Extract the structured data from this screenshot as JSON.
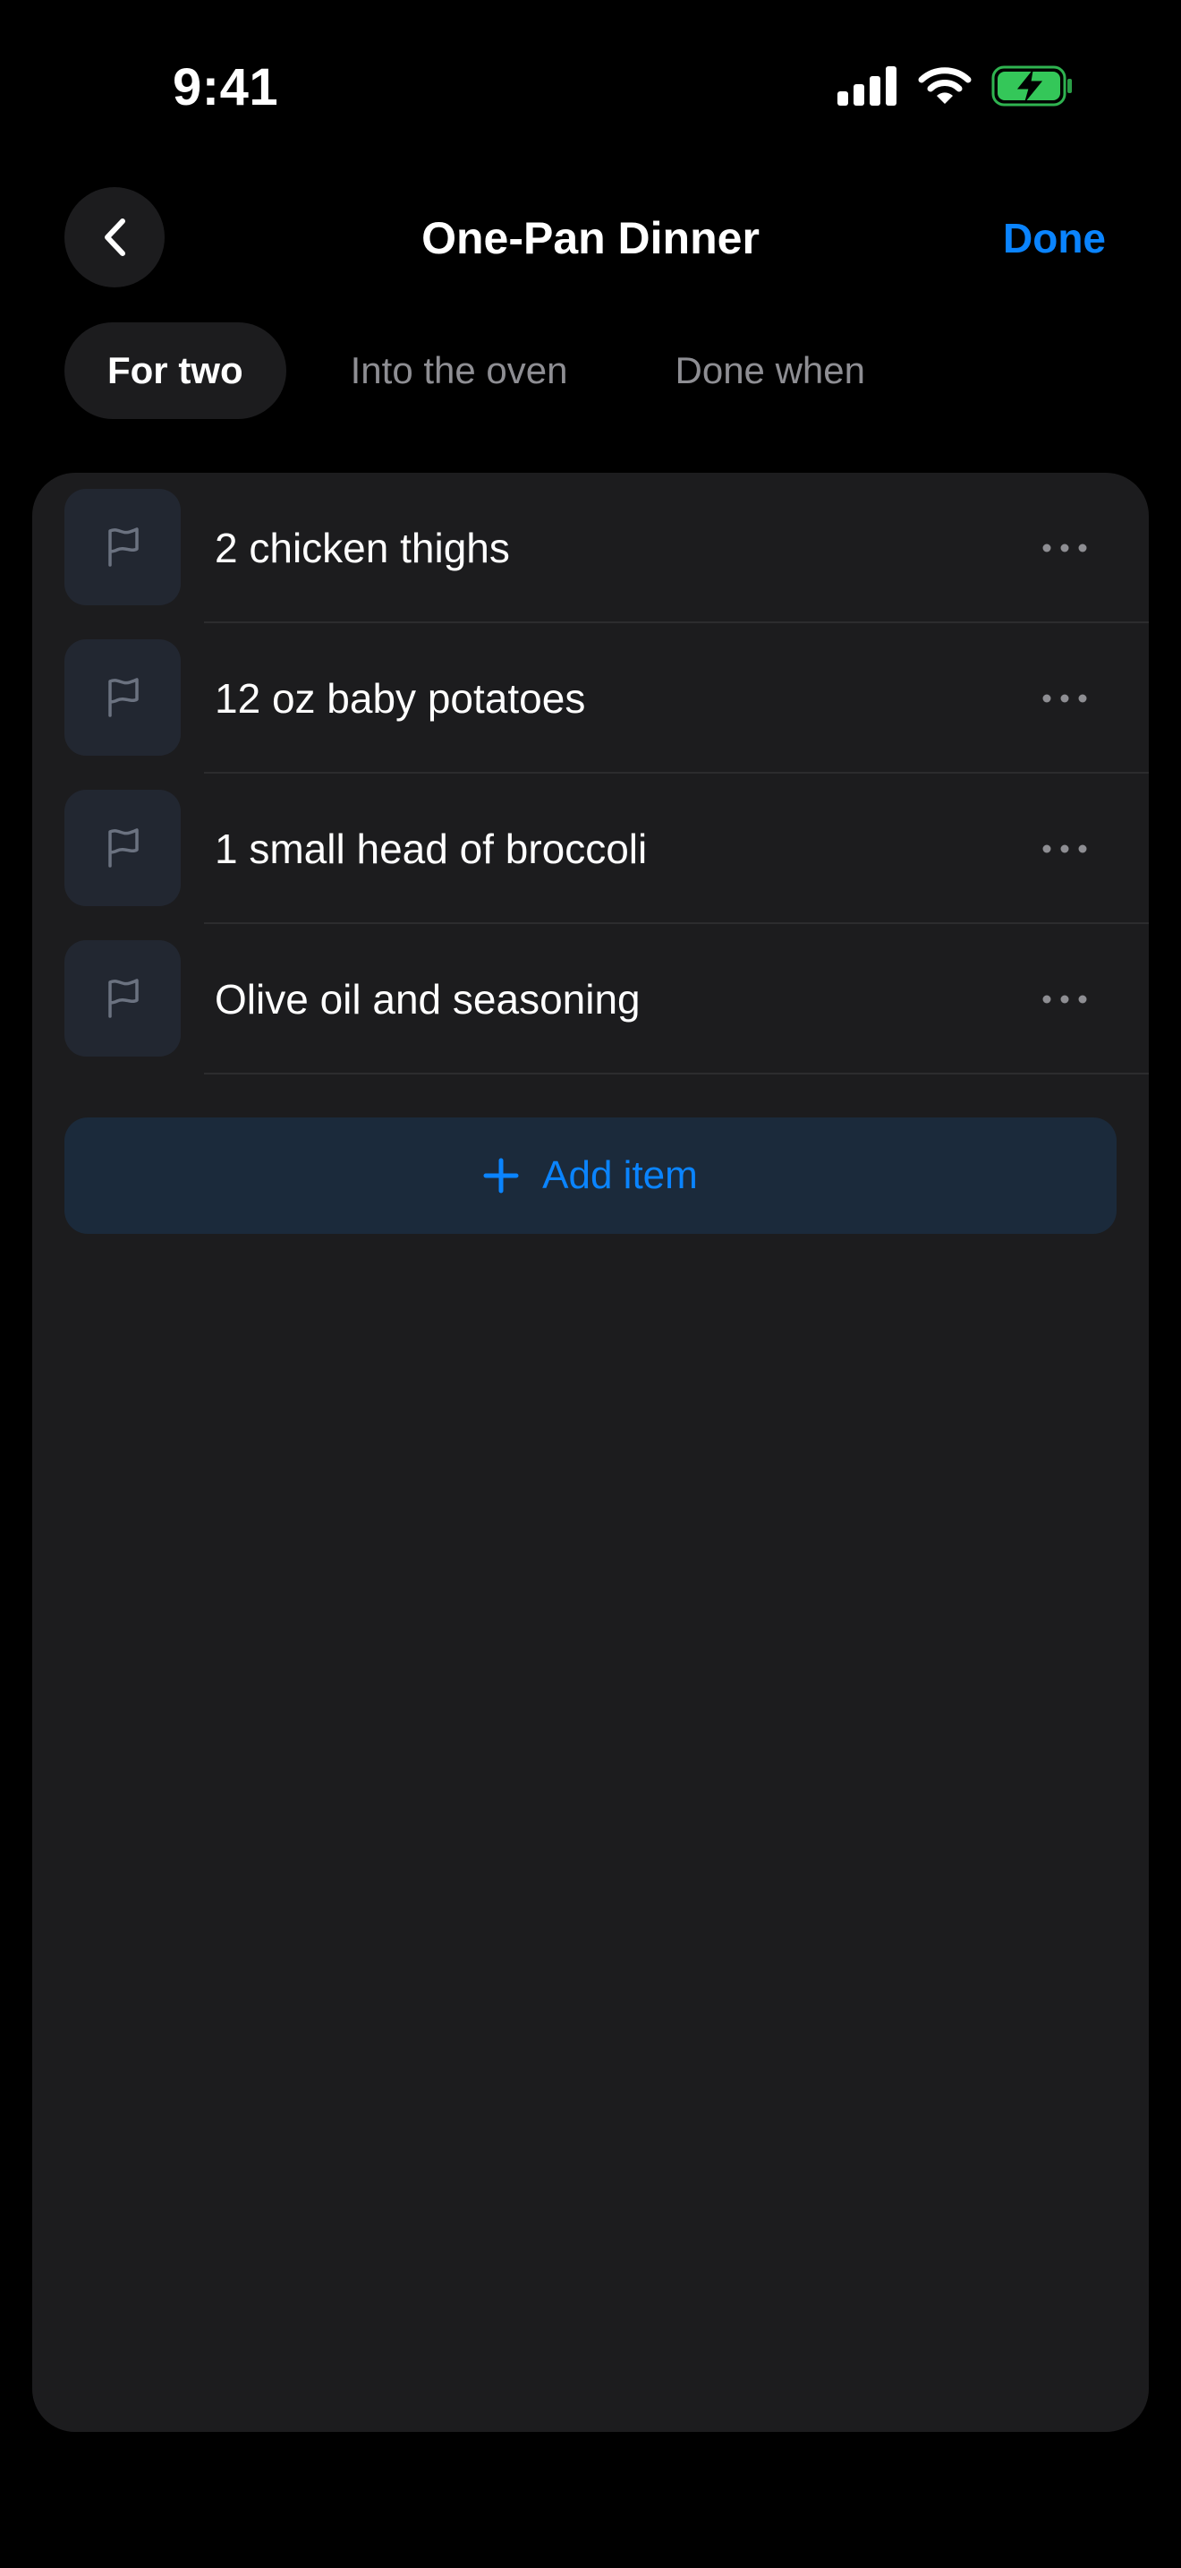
{
  "status_bar": {
    "time": "9:41",
    "icons": [
      "cellular-signal-icon",
      "wifi-icon",
      "battery-charging-icon"
    ]
  },
  "nav": {
    "back_icon": "chevron-left-icon",
    "title": "One-Pan Dinner",
    "done_label": "Done"
  },
  "tabs": [
    {
      "label": "For two",
      "active": true
    },
    {
      "label": "Into the oven",
      "active": false
    },
    {
      "label": "Done when",
      "active": false
    }
  ],
  "items": [
    {
      "label": "2 chicken thighs",
      "icon": "flag-icon",
      "menu_icon": "more-horizontal-icon"
    },
    {
      "label": "12 oz baby potatoes",
      "icon": "flag-icon",
      "menu_icon": "more-horizontal-icon"
    },
    {
      "label": "1 small head of broccoli",
      "icon": "flag-icon",
      "menu_icon": "more-horizontal-icon"
    },
    {
      "label": "Olive oil and seasoning",
      "icon": "flag-icon",
      "menu_icon": "more-horizontal-icon"
    }
  ],
  "add_item": {
    "label": "Add item",
    "icon": "plus-icon"
  },
  "colors": {
    "accent": "#0a84ff",
    "background": "#000000",
    "card": "#1c1c1e",
    "secondary_text": "#8e8e93",
    "battery_green": "#34c759"
  }
}
